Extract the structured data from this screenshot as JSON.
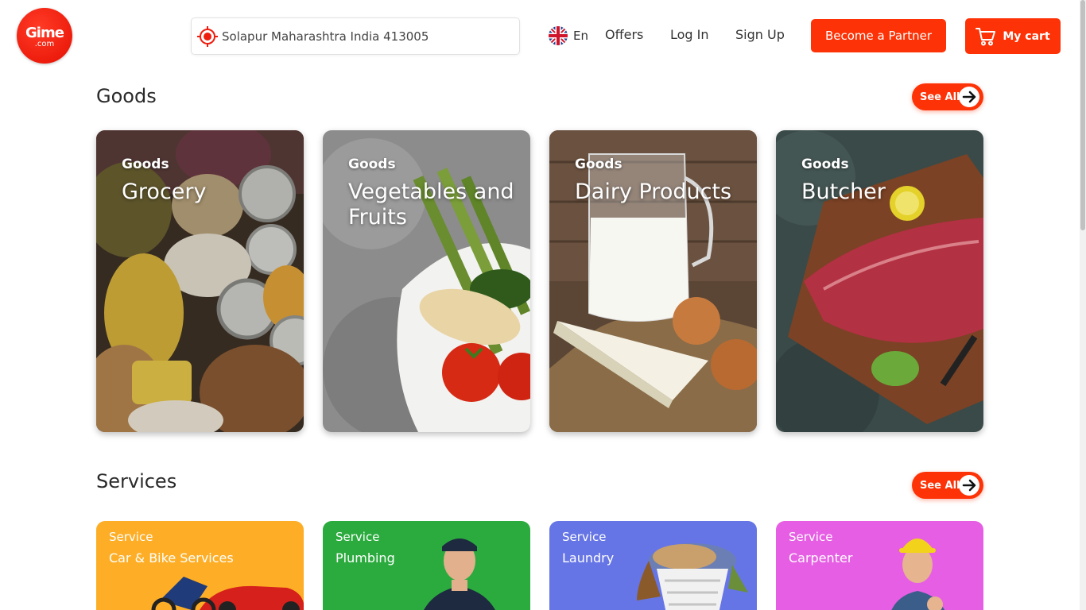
{
  "header": {
    "logo": {
      "brand": "Gime",
      "tld": ".com"
    },
    "location": {
      "value": "Solapur Maharashtra India 413005",
      "icon": "location-target-icon"
    },
    "language": {
      "label": "En",
      "icon": "uk-flag-icon"
    },
    "nav": {
      "offers": "Offers",
      "login": "Log In",
      "signup": "Sign Up"
    },
    "partner_button": "Become a Partner",
    "cart_button": {
      "label": "My cart",
      "icon": "cart-icon"
    }
  },
  "goods": {
    "title": "Goods",
    "see_all": "See All",
    "cards": [
      {
        "kicker": "Goods",
        "title": "Grocery"
      },
      {
        "kicker": "Goods",
        "title": "Vegetables and Fruits"
      },
      {
        "kicker": "Goods",
        "title": "Dairy Products"
      },
      {
        "kicker": "Goods",
        "title": "Butcher"
      }
    ]
  },
  "services": {
    "title": "Services",
    "see_all": "See All",
    "cards": [
      {
        "kicker": "Service",
        "title": "Car & Bike Services",
        "color": "#fdae26"
      },
      {
        "kicker": "Service",
        "title": "Plumbing",
        "color": "#2bab3e"
      },
      {
        "kicker": "Service",
        "title": "Laundry",
        "color": "#6675e5"
      },
      {
        "kicker": "Service",
        "title": "Carpenter",
        "color": "#e65ee3"
      }
    ]
  },
  "colors": {
    "accent": "#fd3206",
    "logo_red": "#ee1d0d"
  }
}
